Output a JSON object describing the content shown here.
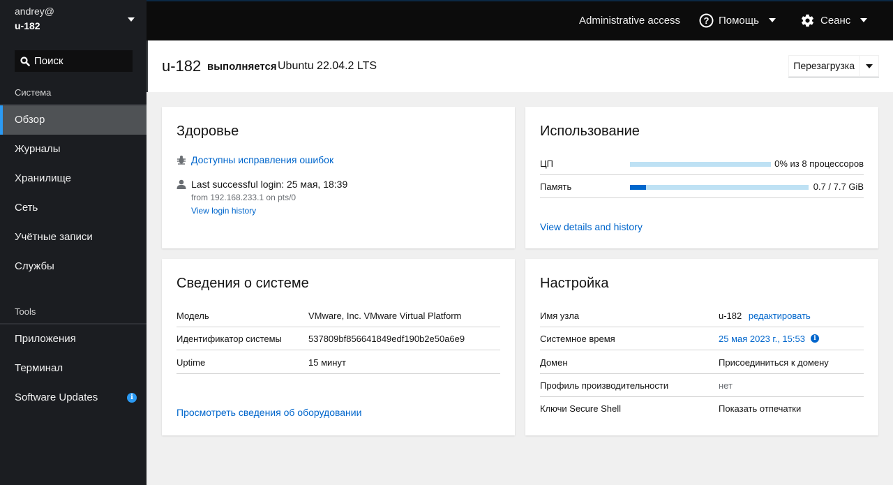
{
  "sidebar": {
    "user": "andrey@",
    "host": "u-182",
    "search_label": "Поиск",
    "section_system": "Система",
    "system_items": [
      {
        "label": "Обзор",
        "active": true
      },
      {
        "label": "Журналы"
      },
      {
        "label": "Хранилище"
      },
      {
        "label": "Сеть"
      },
      {
        "label": "Учётные записи"
      },
      {
        "label": "Службы"
      }
    ],
    "section_tools": "Tools",
    "tools_items": [
      {
        "label": "Приложения"
      },
      {
        "label": "Терминал"
      },
      {
        "label": "Software Updates",
        "badge": "i"
      }
    ]
  },
  "topbar": {
    "admin_access": "Administrative access",
    "help_label": "Помощь",
    "session_label": "Сеанс"
  },
  "header": {
    "hostname": "u-182",
    "running": "выполняется",
    "os": "Ubuntu 22.04.2 LTS",
    "reboot_label": "Перезагрузка"
  },
  "health": {
    "title": "Здоровье",
    "bug_fixes_link": "Доступны исправления ошибок",
    "last_login": "Last successful login: 25 мая, 18:39",
    "login_from": "from 192.168.233.1 on pts/0",
    "login_history_link": "View login history"
  },
  "usage": {
    "title": "Использование",
    "cpu_label": "ЦП",
    "cpu_value": "0% из 8 процессоров",
    "cpu_fraction": 0.0,
    "memory_label": "Память",
    "memory_value": "0.7 / 7.7 GiB",
    "memory_fraction": 0.09,
    "details_link": "View details and history"
  },
  "system_info": {
    "title": "Сведения о системе",
    "rows": [
      {
        "label": "Модель",
        "value": "VMware, Inc. VMware Virtual Platform"
      },
      {
        "label": "Идентификатор системы",
        "value": "537809bf856641849edf190b2e50a6e9"
      },
      {
        "label": "Uptime",
        "value": "15 минут"
      }
    ],
    "hardware_link": "Просмотреть сведения об оборудовании"
  },
  "config": {
    "title": "Настройка",
    "hostname_label": "Имя узла",
    "hostname_value": "u-182",
    "hostname_edit": "редактировать",
    "time_label": "Системное время",
    "time_value": "25 мая 2023 г., 15:53",
    "domain_label": "Домен",
    "domain_value": "Присоединиться к домену",
    "profile_label": "Профиль производительности",
    "profile_value": "нет",
    "ssh_label": "Ключи Secure Shell",
    "ssh_value": "Показать отпечатки"
  },
  "colors": {
    "accent": "#0066cc",
    "sidebar_bg": "#1b1d21",
    "active_indicator": "#2b9af3"
  }
}
